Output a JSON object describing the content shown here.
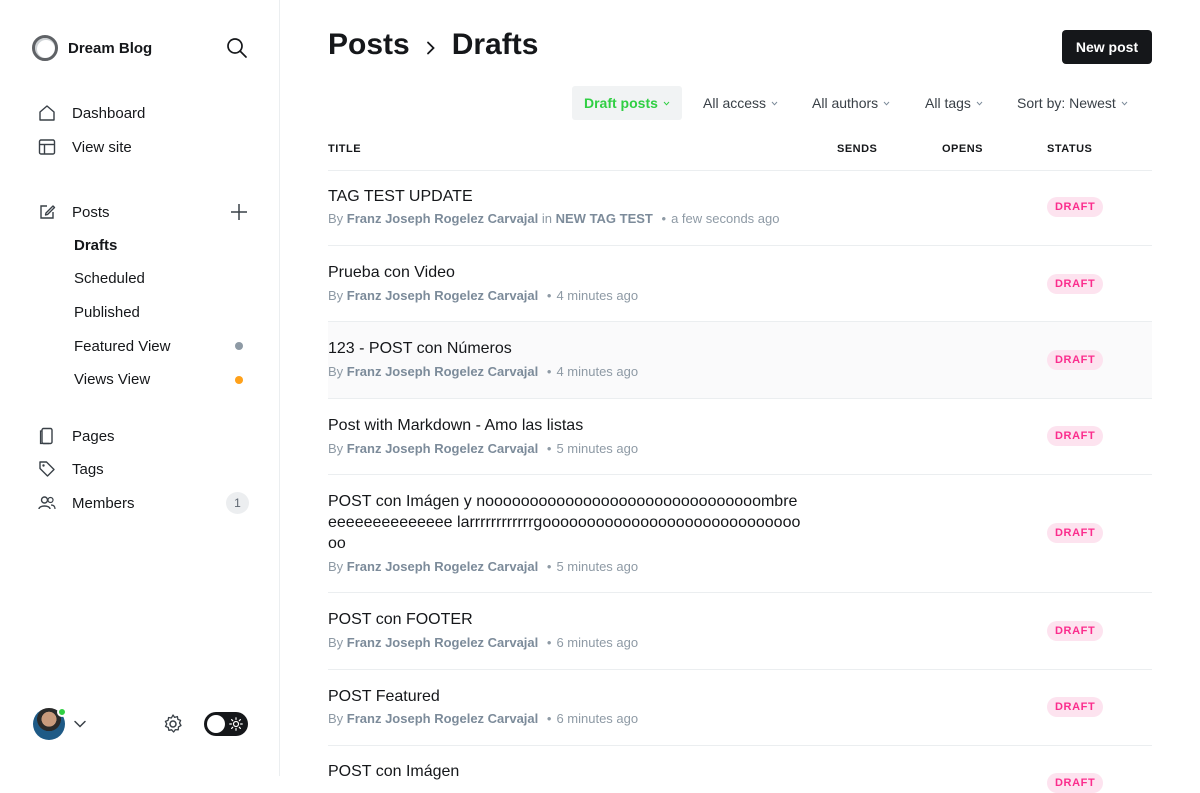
{
  "brand": {
    "name": "Dream Blog"
  },
  "colors": {
    "accent": "#30cf43",
    "draft_bg": "#fde3ef",
    "draft_text": "#fb2d8d",
    "featured_dot": "#8e9aa5",
    "views_dot": "#ffa11a"
  },
  "sidebar": {
    "search_icon": "search-icon",
    "nav": {
      "dashboard": "Dashboard",
      "view_site": "View site"
    },
    "posts": {
      "label": "Posts",
      "sub": {
        "drafts": "Drafts",
        "scheduled": "Scheduled",
        "published": "Published",
        "featured": "Featured View",
        "views": "Views View"
      }
    },
    "pages": "Pages",
    "tags": "Tags",
    "members": {
      "label": "Members",
      "count": "1"
    }
  },
  "header": {
    "crumb_root": "Posts",
    "crumb_current": "Drafts",
    "new_post": "New post"
  },
  "filters": {
    "type": "Draft posts",
    "access": "All access",
    "authors": "All authors",
    "tags": "All tags",
    "sort": "Sort by: Newest"
  },
  "table": {
    "columns": {
      "title": "TITLE",
      "sends": "SENDS",
      "opens": "OPENS",
      "status": "STATUS"
    },
    "rows": [
      {
        "title": "TAG TEST UPDATE",
        "by": "By",
        "author": "Franz Joseph Rogelez Carvajal",
        "in": "in",
        "tag": "NEW TAG TEST",
        "sep": "•",
        "time": "a few seconds ago",
        "status": "DRAFT"
      },
      {
        "title": "Prueba con Video",
        "by": "By",
        "author": "Franz Joseph Rogelez Carvajal",
        "sep": "•",
        "time": "4 minutes ago",
        "status": "DRAFT"
      },
      {
        "title": "123 - POST con Números",
        "by": "By",
        "author": "Franz Joseph Rogelez Carvajal",
        "sep": "•",
        "time": "4 minutes ago",
        "status": "DRAFT"
      },
      {
        "title": "Post with Markdown - Amo las listas",
        "by": "By",
        "author": "Franz Joseph Rogelez Carvajal",
        "sep": "•",
        "time": "5 minutes ago",
        "status": "DRAFT"
      },
      {
        "title": "POST con Imágen y nooooooooooooooooooooooooooooooombreeeeeeeeeeeeeee larrrrrrrrrrrrgooooooooooooooooooooooooooooooo",
        "by": "By",
        "author": "Franz Joseph Rogelez Carvajal",
        "sep": "•",
        "time": "5 minutes ago",
        "status": "DRAFT"
      },
      {
        "title": "POST con FOOTER",
        "by": "By",
        "author": "Franz Joseph Rogelez Carvajal",
        "sep": "•",
        "time": "6 minutes ago",
        "status": "DRAFT"
      },
      {
        "title": "POST Featured",
        "by": "By",
        "author": "Franz Joseph Rogelez Carvajal",
        "sep": "•",
        "time": "6 minutes ago",
        "status": "DRAFT"
      },
      {
        "title": "POST con Imágen",
        "status": "DRAFT"
      }
    ]
  }
}
